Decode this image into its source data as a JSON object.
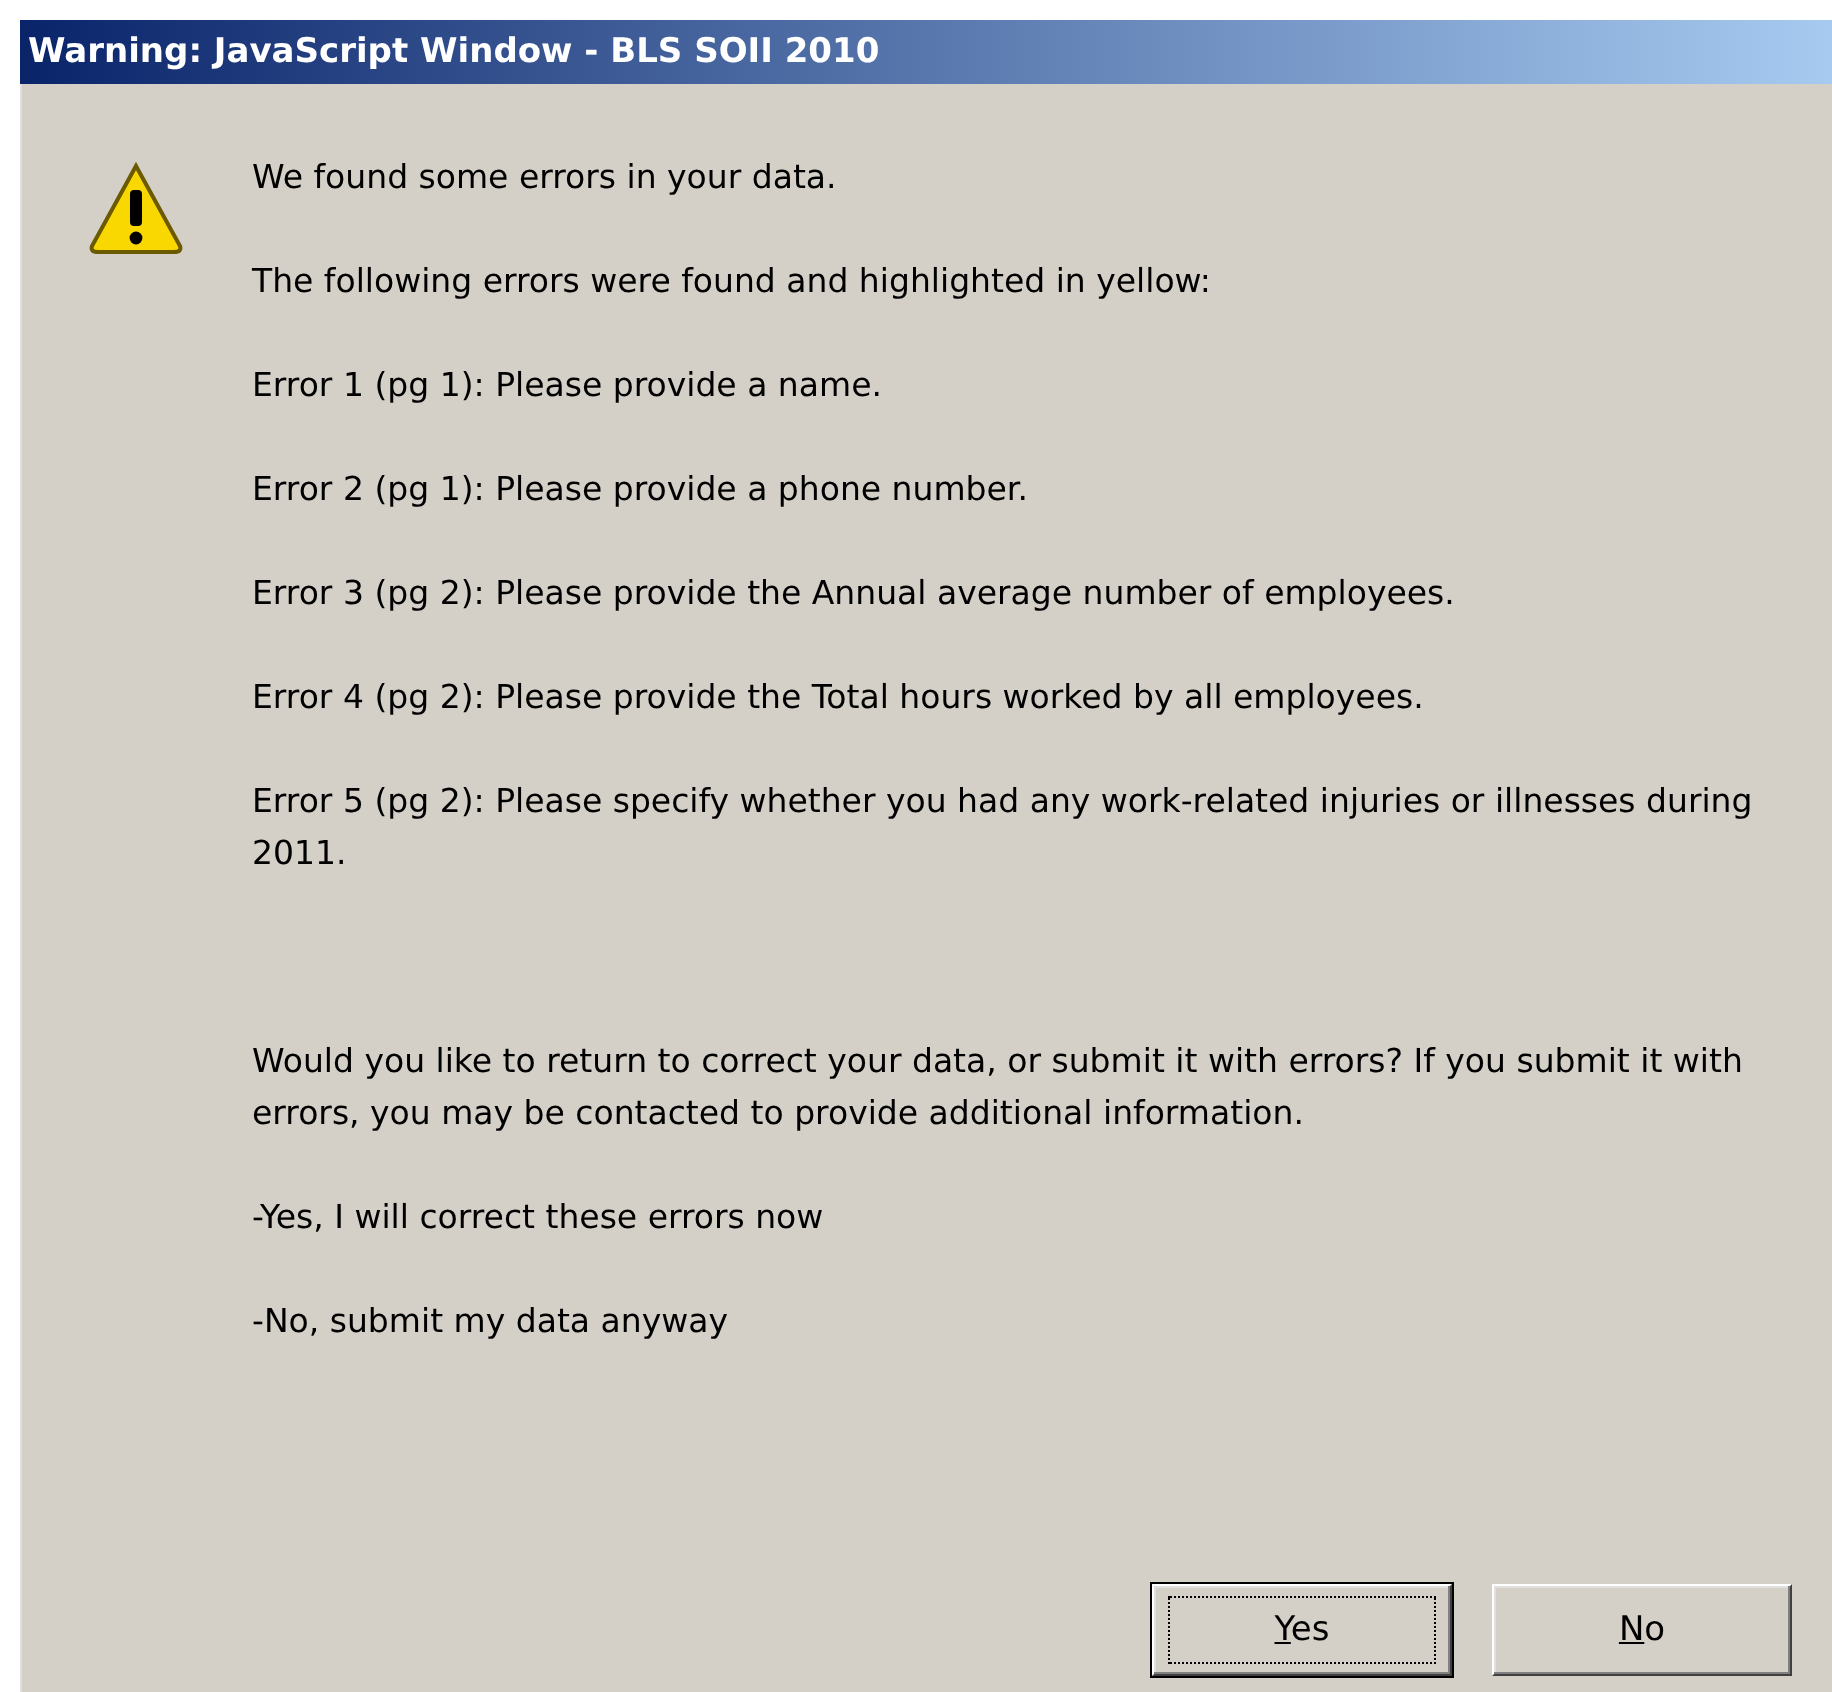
{
  "window": {
    "title": "Warning: JavaScript Window - BLS SOII 2010"
  },
  "message": {
    "heading": "We found some errors in your data.",
    "intro": "The following errors were found and highlighted in yellow:",
    "errors": [
      "Error 1 (pg 1): Please provide a name.",
      "Error 2 (pg 1): Please provide a phone number.",
      "Error 3 (pg 2): Please provide the Annual average number of employees.",
      "Error 4 (pg 2): Please provide the Total hours worked by all employees.",
      "Error 5 (pg 2): Please specify whether you had any work-related injuries or illnesses during 2011."
    ],
    "question": "Would you like to return to correct your data, or submit it with errors? If you submit it with errors, you may be contacted to provide additional information.",
    "options": [
      "-Yes,  I will correct these errors now",
      "-No, submit my data anyway"
    ]
  },
  "buttons": [
    {
      "label": "Yes",
      "selected": true
    },
    {
      "label": "No",
      "selected": false
    }
  ]
}
